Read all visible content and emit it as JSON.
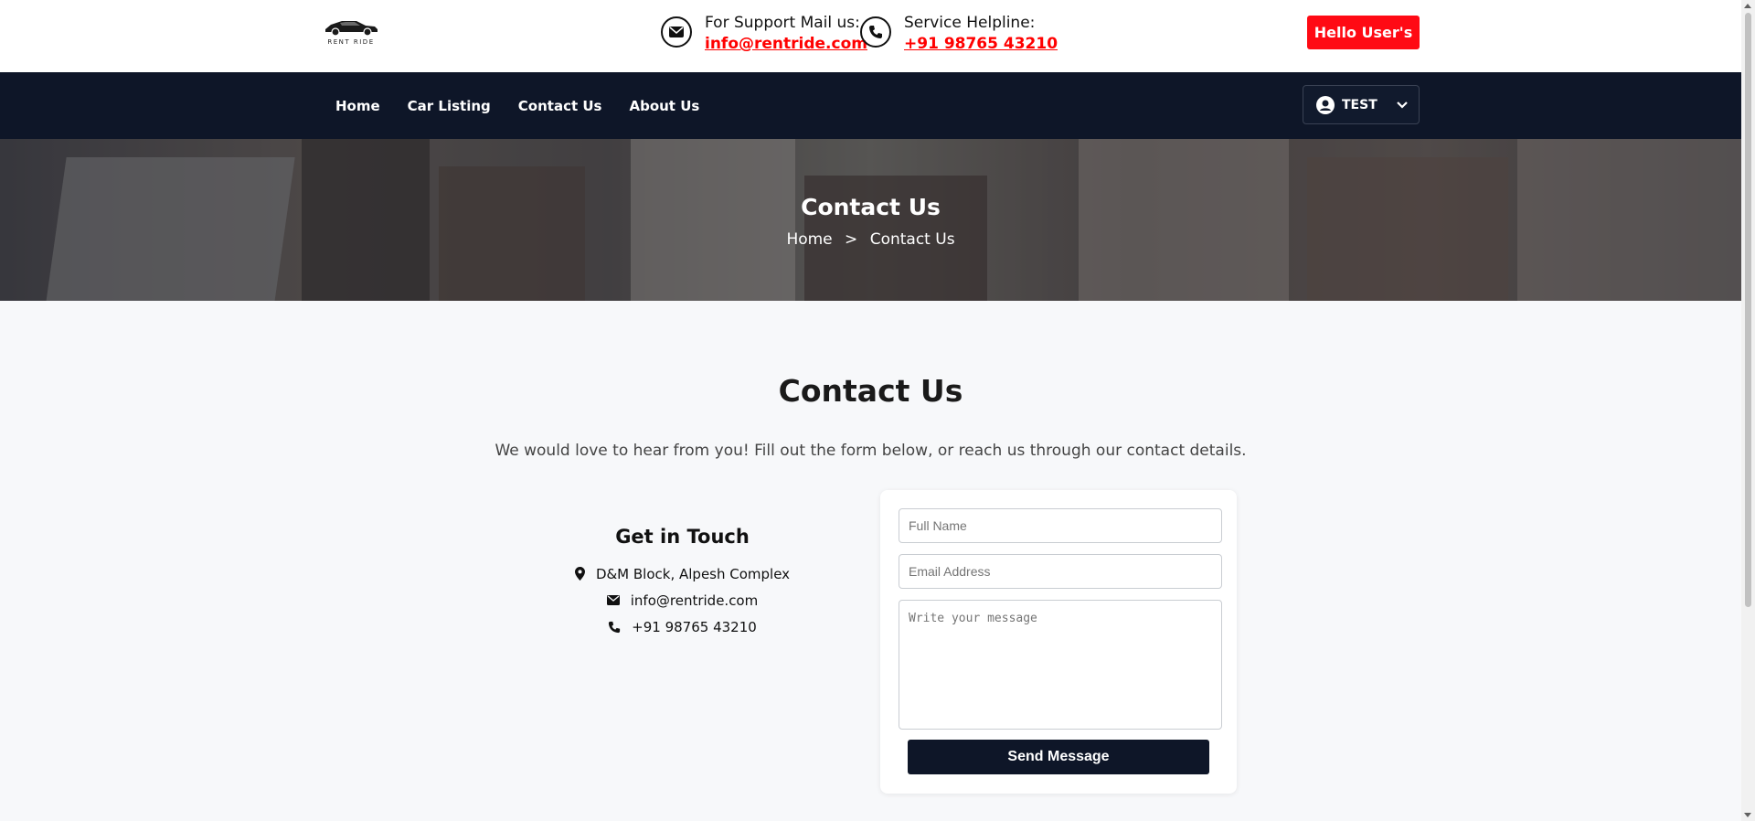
{
  "header": {
    "logo_text": "RENT RIDE",
    "support_label": "For Support Mail us:",
    "support_email": "info@rentride.com",
    "helpline_label": "Service Helpline:",
    "helpline_phone": "+91 98765 43210",
    "hello_button": "Hello User's"
  },
  "nav": {
    "links": [
      "Home",
      "Car Listing",
      "Contact Us",
      "About Us"
    ],
    "user_name": "TEST"
  },
  "hero": {
    "title": "Contact Us",
    "breadcrumb": [
      "Home",
      ">",
      "Contact Us"
    ]
  },
  "main": {
    "title": "Contact Us",
    "intro": "We would love to hear from you! Fill out the form below, or reach us through our contact details."
  },
  "get_in_touch": {
    "title": "Get in Touch",
    "address": "D&M Block, Alpesh Complex",
    "email": "info@rentride.com",
    "phone": "+91 98765 43210"
  },
  "form": {
    "name_placeholder": "Full Name",
    "email_placeholder": "Email Address",
    "message_placeholder": "Write your message",
    "submit_label": "Send Message"
  },
  "colors": {
    "accent_red": "#ff0a14",
    "navy": "#0e1628"
  }
}
